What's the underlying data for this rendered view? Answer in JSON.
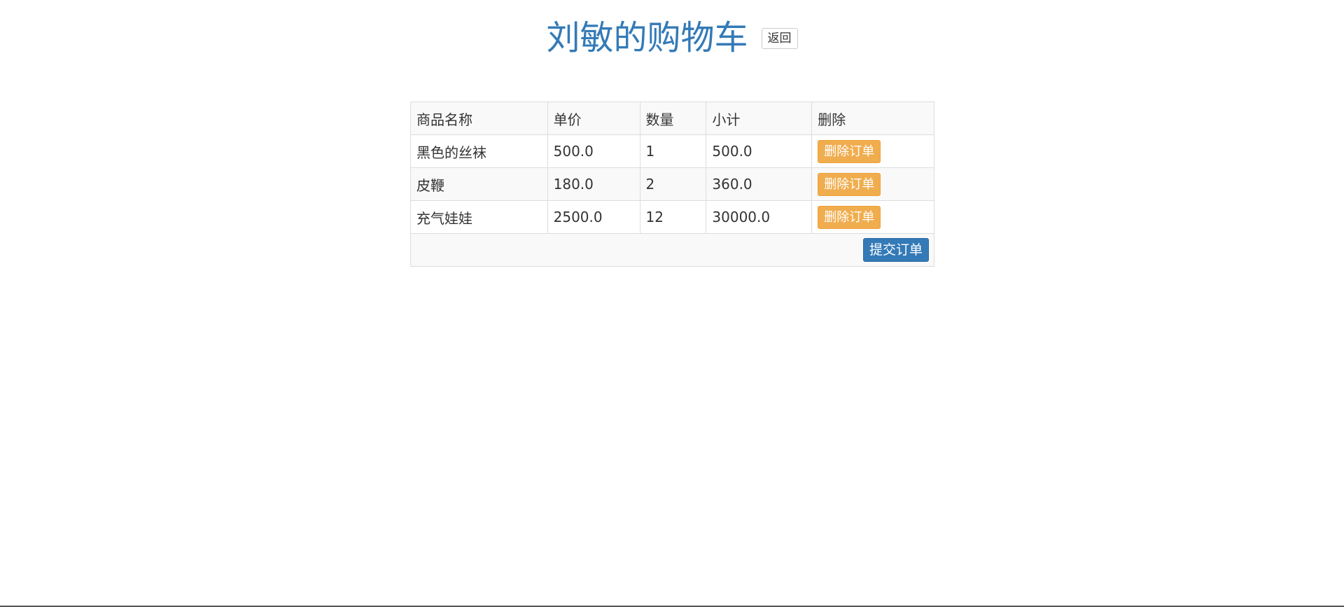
{
  "header": {
    "title": "刘敏的购物车",
    "back_label": "返回"
  },
  "table": {
    "columns": {
      "name": "商品名称",
      "price": "单价",
      "quantity": "数量",
      "subtotal": "小计",
      "delete": "删除"
    },
    "rows": [
      {
        "name": "黑色的丝袜",
        "price": "500.0",
        "quantity": "1",
        "subtotal": "500.0",
        "delete_label": "删除订单"
      },
      {
        "name": "皮鞭",
        "price": "180.0",
        "quantity": "2",
        "subtotal": "360.0",
        "delete_label": "删除订单"
      },
      {
        "name": "充气娃娃",
        "price": "2500.0",
        "quantity": "12",
        "subtotal": "30000.0",
        "delete_label": "删除订单"
      }
    ],
    "submit_label": "提交订单"
  },
  "colors": {
    "title": "#337ab7",
    "delete_button": "#f0ad4e",
    "submit_button": "#337ab7"
  }
}
